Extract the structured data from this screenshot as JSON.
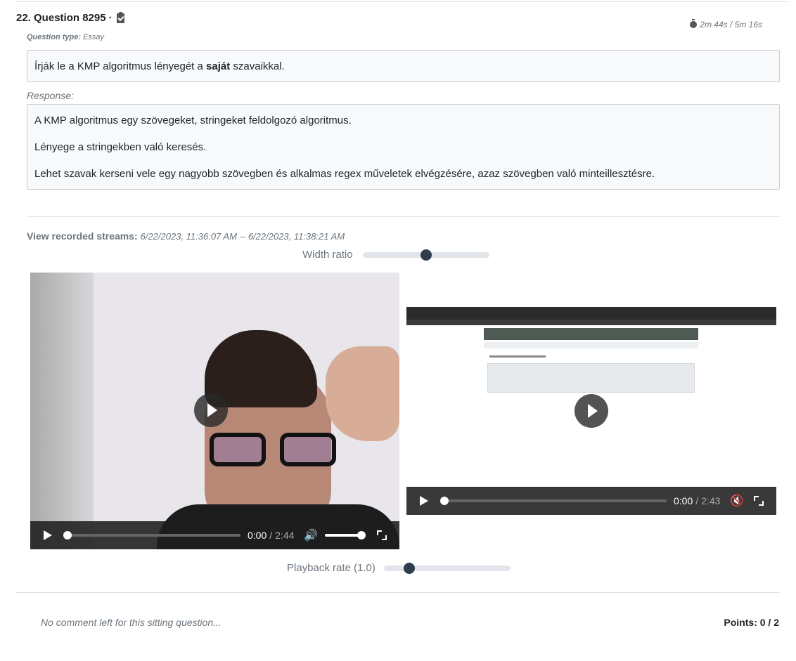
{
  "question": {
    "title": "22. Question 8295 ·",
    "type_label": "Question type:",
    "type_value": "Essay",
    "timer": "2m 44s / 5m 16s",
    "prompt_before": "Írják le a KMP algoritmus lényegét a ",
    "prompt_bold": "saját",
    "prompt_after": " szavaikkal.",
    "response_label": "Response:",
    "response_paragraphs": [
      "A KMP algoritmus egy szövegeket, stringeket feldolgozó algoritmus.",
      "Lényege a stringekben való keresés.",
      "Lehet szavak kerseni vele egy nagyobb szövegben és alkalmas regex műveletek elvégzésére, azaz szövegben való minteillesztésre."
    ]
  },
  "streams": {
    "label": "View recorded streams:",
    "range": "6/22/2023, 11:36:07 AM -- 6/22/2023, 11:38:21 AM",
    "width_ratio_label": "Width ratio",
    "width_ratio_value": 0.5,
    "playback_rate_label": "Playback rate (1.0)",
    "playback_rate_value": 0.17
  },
  "videos": {
    "webcam": {
      "current": "0:00",
      "separator": "/",
      "duration": "2:44",
      "progress": 0,
      "icons": [
        "play-icon",
        "volume-icon",
        "fullscreen-icon"
      ]
    },
    "screen": {
      "current": "0:00",
      "separator": "/",
      "duration": "2:43",
      "progress": 0,
      "icons": [
        "play-icon",
        "muted-icon",
        "fullscreen-icon"
      ]
    }
  },
  "footer": {
    "comment": "No comment left for this sitting question...",
    "points": "Points: 0 / 2"
  }
}
